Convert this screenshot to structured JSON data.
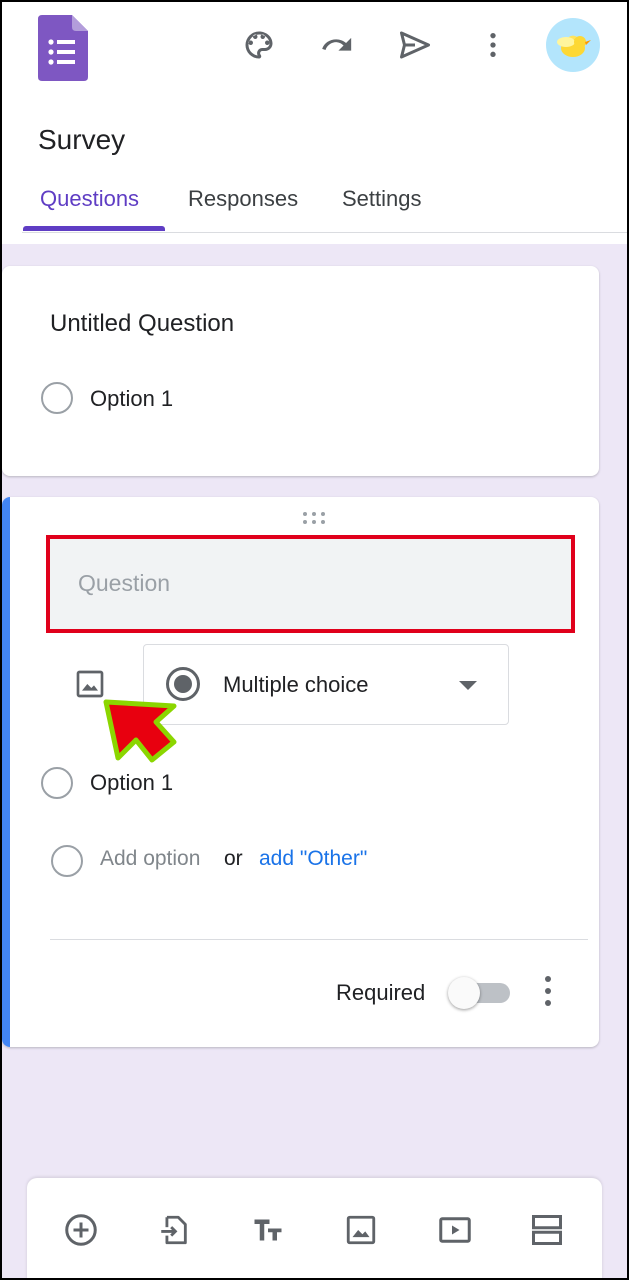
{
  "header": {
    "title": "Survey",
    "icons": [
      "forms-logo",
      "palette-icon",
      "undo-icon",
      "send-icon",
      "more-vert-icon",
      "avatar"
    ]
  },
  "tabs": [
    {
      "label": "Questions",
      "active": true
    },
    {
      "label": "Responses",
      "active": false
    },
    {
      "label": "Settings",
      "active": false
    }
  ],
  "question1": {
    "title": "Untitled Question",
    "options": [
      "Option 1"
    ]
  },
  "question2": {
    "placeholder": "Question",
    "type_label": "Multiple choice",
    "options": [
      "Option 1"
    ],
    "add_option": "Add option",
    "or_text": "or",
    "add_other": "add \"Other\"",
    "required_label": "Required",
    "required_on": false
  },
  "toolbar": {
    "icons": [
      "add-question-icon",
      "import-questions-icon",
      "add-title-icon",
      "add-image-icon",
      "add-video-icon",
      "add-section-icon"
    ]
  },
  "colors": {
    "accent": "#5f3dc4",
    "canvas": "#ede7f6",
    "active_card_bar": "#4285f4",
    "highlight_border": "#e0001b",
    "link": "#1a73e8",
    "arrow_fill": "#e8000f",
    "arrow_outline": "#8bd600"
  }
}
